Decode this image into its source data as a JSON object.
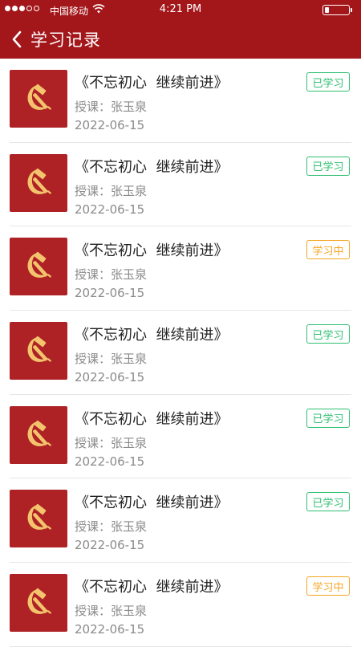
{
  "status_bar": {
    "carrier": "中国移动",
    "time": "4:21 PM"
  },
  "nav": {
    "title": "学习记录",
    "back_icon": "chevron-left-icon"
  },
  "colors": {
    "header_bg": "#a3171b",
    "thumb_bg": "#ae2225",
    "learned": "#2fbf71",
    "learning": "#f5a623"
  },
  "records": [
    {
      "title": "《不忘初心  继续前进》",
      "teacher": "授课：张玉泉",
      "date": "2022-06-15",
      "status": "已学习",
      "state": "learned"
    },
    {
      "title": "《不忘初心  继续前进》",
      "teacher": "授课：张玉泉",
      "date": "2022-06-15",
      "status": "已学习",
      "state": "learned"
    },
    {
      "title": "《不忘初心  继续前进》",
      "teacher": "授课：张玉泉",
      "date": "2022-06-15",
      "status": "学习中",
      "state": "learning"
    },
    {
      "title": "《不忘初心  继续前进》",
      "teacher": "授课：张玉泉",
      "date": "2022-06-15",
      "status": "已学习",
      "state": "learned"
    },
    {
      "title": "《不忘初心  继续前进》",
      "teacher": "授课：张玉泉",
      "date": "2022-06-15",
      "status": "已学习",
      "state": "learned"
    },
    {
      "title": "《不忘初心  继续前进》",
      "teacher": "授课：张玉泉",
      "date": "2022-06-15",
      "status": "已学习",
      "state": "learned"
    },
    {
      "title": "《不忘初心  继续前进》",
      "teacher": "授课：张玉泉",
      "date": "2022-06-15",
      "status": "学习中",
      "state": "learning"
    }
  ]
}
